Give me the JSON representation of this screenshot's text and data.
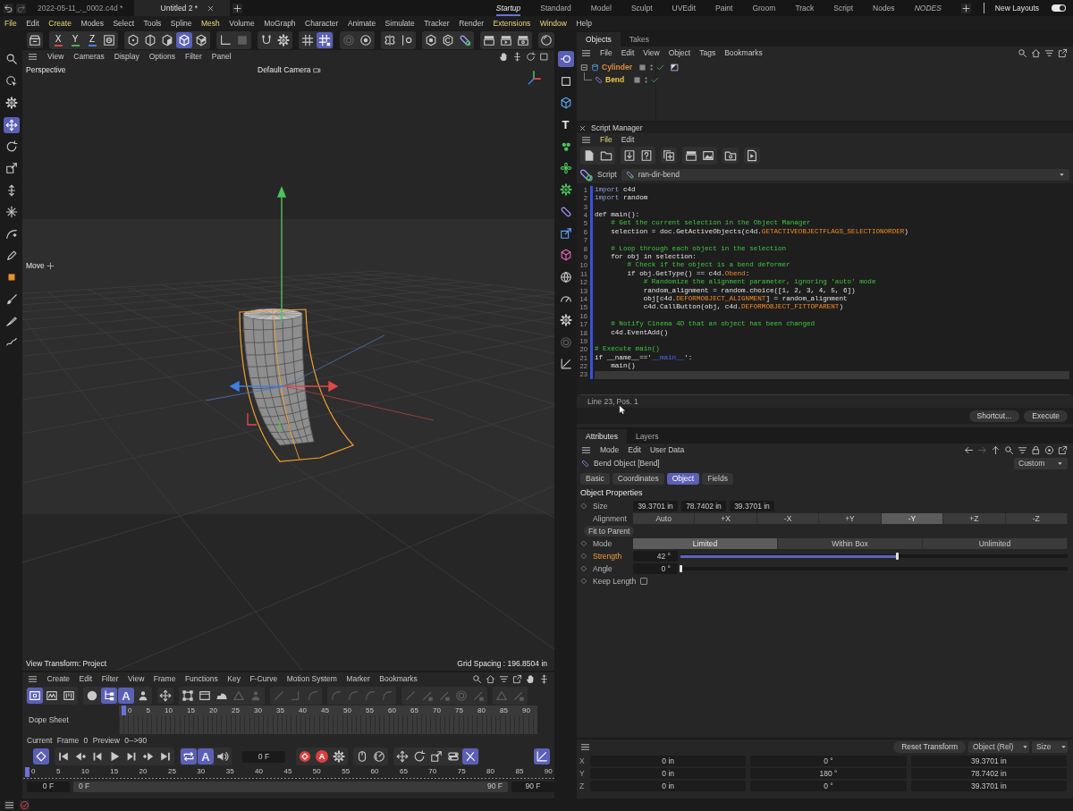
{
  "top_bar": {
    "file_tabs": [
      {
        "label": "2022-05-11_._0002.c4d *",
        "selected": false
      },
      {
        "label": "Untitled 2 *",
        "selected": true
      }
    ],
    "layouts": [
      {
        "label": "Startup",
        "selected": true,
        "italic": true
      },
      {
        "label": "Standard",
        "selected": false,
        "italic": false
      },
      {
        "label": "Model",
        "selected": false,
        "italic": false
      },
      {
        "label": "Sculpt",
        "selected": false,
        "italic": false
      },
      {
        "label": "UVEdit",
        "selected": false,
        "italic": false
      },
      {
        "label": "Paint",
        "selected": false,
        "italic": false
      },
      {
        "label": "Groom",
        "selected": false,
        "italic": false
      },
      {
        "label": "Track",
        "selected": false,
        "italic": false
      },
      {
        "label": "Script",
        "selected": false,
        "italic": false
      },
      {
        "label": "Nodes",
        "selected": false,
        "italic": false
      },
      {
        "label": "NODES",
        "selected": false,
        "italic": true
      }
    ],
    "new_layouts": {
      "label": "New Layouts",
      "on": true
    }
  },
  "menu_bar": [
    {
      "label": "File",
      "highlighted": true
    },
    {
      "label": "Edit",
      "highlighted": false
    },
    {
      "label": "Create",
      "highlighted": true
    },
    {
      "label": "Modes",
      "highlighted": false
    },
    {
      "label": "Select",
      "highlighted": false
    },
    {
      "label": "Tools",
      "highlighted": false
    },
    {
      "label": "Spline",
      "highlighted": false
    },
    {
      "label": "Mesh",
      "highlighted": true
    },
    {
      "label": "Volume",
      "highlighted": false
    },
    {
      "label": "MoGraph",
      "highlighted": false
    },
    {
      "label": "Character",
      "highlighted": false
    },
    {
      "label": "Animate",
      "highlighted": false
    },
    {
      "label": "Simulate",
      "highlighted": false
    },
    {
      "label": "Tracker",
      "highlighted": false
    },
    {
      "label": "Render",
      "highlighted": false
    },
    {
      "label": "Extensions",
      "highlighted": true
    },
    {
      "label": "Window",
      "highlighted": true
    },
    {
      "label": "Help",
      "highlighted": false
    }
  ],
  "main_toolbar": [
    {
      "buttons": [
        {
          "kind": "icon",
          "on": false,
          "disabled": false
        }
      ]
    },
    {
      "buttons": [
        {
          "kind": "axis",
          "glyph": "X",
          "color": "#d24545",
          "on": false,
          "disabled": false
        },
        {
          "kind": "axis",
          "glyph": "Y",
          "color": "#45b04c",
          "on": false,
          "disabled": false
        },
        {
          "kind": "axis",
          "glyph": "Z",
          "color": "#3f7fe0",
          "on": false,
          "disabled": false
        },
        {
          "kind": "icon",
          "on": false,
          "disabled": false
        }
      ]
    },
    {
      "buttons": [
        {
          "kind": "icon",
          "on": false,
          "disabled": false
        },
        {
          "kind": "icon",
          "on": false,
          "disabled": false
        },
        {
          "kind": "icon",
          "on": false,
          "disabled": false
        },
        {
          "kind": "icon",
          "on": true,
          "disabled": false
        },
        {
          "kind": "icon",
          "on": false,
          "disabled": false
        }
      ]
    },
    {
      "buttons": [
        {
          "kind": "icon",
          "on": false,
          "disabled": false
        },
        {
          "kind": "icon",
          "on": false,
          "disabled": true
        }
      ]
    },
    {
      "buttons": [
        {
          "kind": "icon",
          "on": false,
          "disabled": false
        },
        {
          "kind": "icon",
          "on": false,
          "disabled": false
        }
      ]
    },
    {
      "buttons": [
        {
          "kind": "icon",
          "on": false,
          "disabled": false
        },
        {
          "kind": "icon",
          "on": true,
          "disabled": false
        }
      ]
    },
    {
      "buttons": [
        {
          "kind": "icon",
          "on": false,
          "disabled": true
        },
        {
          "kind": "icon",
          "on": false,
          "disabled": false
        }
      ]
    },
    {
      "buttons": [
        {
          "kind": "icon",
          "on": false,
          "disabled": false
        },
        {
          "kind": "icon",
          "on": false,
          "disabled": false
        }
      ]
    },
    {
      "buttons": [
        {
          "kind": "icon",
          "on": false,
          "disabled": false
        },
        {
          "kind": "icon",
          "on": false,
          "disabled": false
        },
        {
          "kind": "icon",
          "on": false,
          "disabled": false
        }
      ]
    },
    {
      "buttons": [
        {
          "kind": "icon",
          "on": false,
          "disabled": false
        },
        {
          "kind": "icon",
          "on": false,
          "disabled": false
        },
        {
          "kind": "icon",
          "on": false,
          "disabled": false
        }
      ]
    },
    {
      "buttons": [
        {
          "kind": "icon",
          "on": false,
          "disabled": false
        }
      ]
    }
  ],
  "left_tools": [
    {
      "buttons": [
        {
          "kind": "icon",
          "on": false
        }
      ]
    },
    {
      "buttons": [
        {
          "kind": "icon",
          "on": false
        },
        {
          "kind": "icon",
          "on": false
        }
      ]
    },
    {
      "buttons": [
        {
          "kind": "icon",
          "on": true
        },
        {
          "kind": "icon",
          "on": false
        },
        {
          "kind": "icon",
          "on": false
        }
      ]
    },
    {
      "buttons": [
        {
          "kind": "icon",
          "on": false
        },
        {
          "kind": "icon",
          "on": false
        }
      ]
    },
    {
      "buttons": [
        {
          "kind": "icon",
          "on": false
        },
        {
          "kind": "icon",
          "on": false
        },
        {
          "kind": "icon",
          "on": false
        }
      ]
    },
    {
      "buttons": [
        {
          "kind": "icon",
          "on": false
        },
        {
          "kind": "icon",
          "on": false
        },
        {
          "kind": "icon",
          "on": false
        }
      ]
    }
  ],
  "side_tools": [
    {
      "buttons": [
        {
          "kind": "icon",
          "on": true,
          "disabled": false
        }
      ]
    },
    {
      "buttons": [
        {
          "kind": "icon",
          "on": false,
          "disabled": false
        },
        {
          "kind": "icon",
          "on": false,
          "disabled": false
        },
        {
          "kind": "glyph",
          "glyph": "T",
          "on": false,
          "disabled": false
        }
      ]
    },
    {
      "buttons": [
        {
          "kind": "icon",
          "on": false,
          "disabled": false
        },
        {
          "kind": "icon",
          "on": false,
          "disabled": false
        },
        {
          "kind": "icon",
          "on": false,
          "disabled": false
        }
      ]
    },
    {
      "buttons": [
        {
          "kind": "icon",
          "on": false,
          "disabled": false
        },
        {
          "kind": "icon",
          "on": false,
          "disabled": false
        },
        {
          "kind": "icon",
          "on": false,
          "disabled": false
        }
      ]
    },
    {
      "buttons": [
        {
          "kind": "icon",
          "on": false,
          "disabled": false
        },
        {
          "kind": "icon",
          "on": false,
          "disabled": false
        },
        {
          "kind": "icon",
          "on": false,
          "disabled": false
        }
      ]
    },
    {
      "buttons": [
        {
          "kind": "icon",
          "on": false,
          "disabled": true
        },
        {
          "kind": "icon",
          "on": false,
          "disabled": false
        }
      ]
    }
  ],
  "viewport": {
    "menu": [
      "View",
      "Cameras",
      "Display",
      "Options",
      "Filter",
      "Panel"
    ],
    "view_name": "Perspective",
    "camera": "Default Camera",
    "tool": "Move",
    "view_transform": "View Transform: Project",
    "grid_spacing": "Grid Spacing : 196.8504 in"
  },
  "timeline": {
    "menu": [
      "Create",
      "Edit",
      "Filter",
      "View",
      "Frame",
      "Functions",
      "Key",
      "F-Curve",
      "Motion System",
      "Marker",
      "Bookmarks"
    ],
    "toolbar": [
      {
        "buttons": [
          {
            "kind": "icon",
            "on": true,
            "disabled": false
          },
          {
            "kind": "icon",
            "on": false,
            "disabled": false
          },
          {
            "kind": "icon",
            "on": false,
            "disabled": false
          }
        ]
      },
      {
        "buttons": [
          {
            "kind": "icon",
            "on": false,
            "disabled": false
          },
          {
            "kind": "icon",
            "on": true,
            "disabled": false
          },
          {
            "kind": "glyph",
            "glyph": "A",
            "on": true,
            "disabled": false
          },
          {
            "kind": "icon",
            "on": false,
            "disabled": false
          }
        ]
      },
      {
        "buttons": [
          {
            "kind": "icon",
            "on": false,
            "disabled": false
          }
        ]
      },
      {
        "buttons": [
          {
            "kind": "icon",
            "on": false,
            "disabled": false
          },
          {
            "kind": "icon",
            "on": false,
            "disabled": false
          },
          {
            "kind": "icon",
            "on": false,
            "disabled": false
          },
          {
            "kind": "icon",
            "on": false,
            "disabled": true
          },
          {
            "kind": "icon",
            "on": false,
            "disabled": true
          }
        ]
      },
      {
        "buttons": [
          {
            "kind": "icon",
            "on": false,
            "disabled": true
          },
          {
            "kind": "icon",
            "on": false,
            "disabled": true
          },
          {
            "kind": "icon",
            "on": false,
            "disabled": true
          }
        ]
      },
      {
        "buttons": [
          {
            "kind": "icon",
            "on": false,
            "disabled": true
          },
          {
            "kind": "icon",
            "on": false,
            "disabled": true
          },
          {
            "kind": "icon",
            "on": false,
            "disabled": true
          },
          {
            "kind": "icon",
            "on": false,
            "disabled": true
          }
        ]
      },
      {
        "buttons": [
          {
            "kind": "icon",
            "on": false,
            "disabled": true
          },
          {
            "kind": "icon",
            "on": false,
            "disabled": true
          },
          {
            "kind": "icon",
            "on": false,
            "disabled": true
          },
          {
            "kind": "icon",
            "on": false,
            "disabled": true
          },
          {
            "kind": "icon",
            "on": false,
            "disabled": true
          }
        ]
      },
      {
        "buttons": [
          {
            "kind": "icon",
            "on": false,
            "disabled": true
          },
          {
            "kind": "icon",
            "on": false,
            "disabled": true
          }
        ]
      }
    ],
    "dope_sheet": {
      "label": "Dope Sheet",
      "ticks": [
        "0",
        "5",
        "10",
        "15",
        "20",
        "25",
        "30",
        "35",
        "40",
        "45",
        "50",
        "55",
        "60",
        "65",
        "70",
        "75",
        "80",
        "85",
        "90"
      ],
      "playhead": {
        "level": 0
      }
    },
    "frame_info": "Current Frame 0 Preview 0-->90",
    "transport": {
      "left": [
        {
          "buttons": [
            {
              "kind": "icon",
              "on": true
            }
          ]
        },
        {
          "buttons": [
            {
              "kind": "icon",
              "on": false
            },
            {
              "kind": "icon",
              "on": false
            },
            {
              "kind": "icon",
              "on": false
            },
            {
              "kind": "icon",
              "on": false
            },
            {
              "kind": "icon",
              "on": false
            },
            {
              "kind": "icon",
              "on": false
            },
            {
              "kind": "icon",
              "on": false
            }
          ]
        },
        {
          "buttons": [
            {
              "kind": "icon",
              "on": true
            },
            {
              "kind": "glyph",
              "glyph": "A",
              "on": true
            },
            {
              "kind": "icon",
              "on": false
            }
          ]
        }
      ],
      "frame_field": "0 F",
      "right": [
        {
          "buttons": [
            {
              "kind": "icon",
              "on": false
            },
            {
              "kind": "record_glyph",
              "glyph": "A",
              "on": false
            },
            {
              "kind": "icon",
              "on": false
            }
          ]
        },
        {
          "buttons": [
            {
              "kind": "icon",
              "on": false
            },
            {
              "kind": "icon",
              "on": false
            }
          ]
        },
        {
          "buttons": [
            {
              "kind": "icon",
              "on": false
            },
            {
              "kind": "icon",
              "on": false
            },
            {
              "kind": "icon",
              "on": false
            },
            {
              "kind": "icon",
              "on": false
            },
            {
              "kind": "icon",
              "on": true
            }
          ]
        }
      ],
      "end": [
        {
          "buttons": [
            {
              "kind": "icon",
              "on": true
            }
          ]
        }
      ]
    },
    "ruler": {
      "ticks": [
        "0",
        "5",
        "10",
        "15",
        "20",
        "25",
        "30",
        "35",
        "40",
        "45",
        "50",
        "55",
        "60",
        "65",
        "70",
        "75",
        "80",
        "85",
        "90"
      ],
      "playhead": {
        "level": 0
      }
    },
    "start_field": "0 F",
    "range": {
      "start": "0 F",
      "end": "90 F"
    },
    "end_field": "90 F"
  },
  "objects": {
    "tabs": [
      {
        "label": "Objects",
        "selected": true
      },
      {
        "label": "Takes",
        "selected": false
      }
    ],
    "menu": [
      "File",
      "Edit",
      "View",
      "Object",
      "Tags",
      "Bookmarks"
    ],
    "tree": [
      {
        "name": "Cylinder",
        "color": "#e08a3c",
        "enabled": true,
        "tagged": true,
        "expanded": true,
        "children": [
          {
            "name": "Bend",
            "color": "#e8c24a",
            "enabled": true,
            "tagged": false
          }
        ]
      }
    ]
  },
  "script_manager": {
    "title": "Script Manager",
    "menu": [
      {
        "label": "File",
        "highlighted": true
      },
      {
        "label": "Edit",
        "highlighted": false
      }
    ],
    "toolbar": [
      {
        "buttons": [
          {
            "kind": "icon",
            "on": false
          },
          {
            "kind": "icon",
            "on": false
          }
        ]
      },
      {
        "buttons": [
          {
            "kind": "icon",
            "on": false
          },
          {
            "kind": "icon",
            "on": false
          }
        ]
      },
      {
        "buttons": [
          {
            "kind": "icon",
            "on": false
          }
        ]
      },
      {
        "buttons": [
          {
            "kind": "icon",
            "on": false
          },
          {
            "kind": "icon",
            "on": false
          }
        ]
      },
      {
        "buttons": [
          {
            "kind": "icon",
            "on": false
          }
        ]
      },
      {
        "buttons": [
          {
            "kind": "icon",
            "on": false
          }
        ]
      }
    ],
    "script_label": "Script",
    "script_name": "ran-dir-bend",
    "code": [
      {
        "num": "1",
        "current": false,
        "segments": [
          {
            "text": "import",
            "kind": "keyword"
          },
          {
            "text": " c4d",
            "kind": "plain"
          }
        ]
      },
      {
        "num": "2",
        "current": false,
        "segments": [
          {
            "text": "import",
            "kind": "keyword"
          },
          {
            "text": " random",
            "kind": "plain"
          }
        ]
      },
      {
        "num": "3",
        "current": false
      },
      {
        "num": "4",
        "current": false,
        "segments": [
          {
            "text": "def main():",
            "kind": "plain"
          }
        ]
      },
      {
        "num": "5",
        "current": false,
        "segments": [
          {
            "text": "    # Get the current selection in the Object Manager",
            "kind": "comment"
          }
        ]
      },
      {
        "num": "6",
        "current": false,
        "segments": [
          {
            "text": "    selection = doc.GetActiveObjects(c4d.",
            "kind": "plain"
          },
          {
            "text": "GETACTIVEOBJECTFLAGS_SELECTIONORDER",
            "kind": "constant"
          },
          {
            "text": ")",
            "kind": "plain"
          }
        ]
      },
      {
        "num": "7",
        "current": false
      },
      {
        "num": "8",
        "current": false,
        "segments": [
          {
            "text": "    # Loop through each object in the selection",
            "kind": "comment"
          }
        ]
      },
      {
        "num": "9",
        "current": false,
        "segments": [
          {
            "text": "    for obj in selection:",
            "kind": "plain"
          }
        ]
      },
      {
        "num": "10",
        "current": false,
        "segments": [
          {
            "text": "        # Check if the object is a bend deformer",
            "kind": "comment"
          }
        ]
      },
      {
        "num": "11",
        "current": false,
        "segments": [
          {
            "text": "        if obj.GetType() == c4d.",
            "kind": "plain"
          },
          {
            "text": "Obend",
            "kind": "constant"
          },
          {
            "text": ":",
            "kind": "plain"
          }
        ]
      },
      {
        "num": "12",
        "current": false,
        "segments": [
          {
            "text": "            # Randomize the alignment parameter, ignoring 'auto' mode",
            "kind": "comment"
          }
        ]
      },
      {
        "num": "13",
        "current": false,
        "segments": [
          {
            "text": "            random_alignment = random.choice([1, 2, 3, 4, 5, 6])",
            "kind": "plain"
          }
        ]
      },
      {
        "num": "14",
        "current": false,
        "segments": [
          {
            "text": "            obj[c4d.",
            "kind": "plain"
          },
          {
            "text": "DEFORMOBJECT_ALIGNMENT",
            "kind": "constant"
          },
          {
            "text": "] = random_alignment",
            "kind": "plain"
          }
        ]
      },
      {
        "num": "15",
        "current": false,
        "segments": [
          {
            "text": "            c4d.CallButton(obj, c4d.",
            "kind": "plain"
          },
          {
            "text": "DEFORMOBJECT_FITTOPARENT",
            "kind": "constant"
          },
          {
            "text": ")",
            "kind": "plain"
          }
        ]
      },
      {
        "num": "16",
        "current": false
      },
      {
        "num": "17",
        "current": false,
        "segments": [
          {
            "text": "    # Notify Cinema 4D that an object has been changed",
            "kind": "comment"
          }
        ]
      },
      {
        "num": "18",
        "current": false,
        "segments": [
          {
            "text": "    c4d.EventAdd()",
            "kind": "plain"
          }
        ]
      },
      {
        "num": "19",
        "current": false
      },
      {
        "num": "20",
        "current": false,
        "segments": [
          {
            "text": "# Execute main()",
            "kind": "comment"
          }
        ]
      },
      {
        "num": "21",
        "current": false,
        "segments": [
          {
            "text": "if __name__=='",
            "kind": "plain"
          },
          {
            "text": "__main__",
            "kind": "string"
          },
          {
            "text": "':",
            "kind": "plain"
          }
        ]
      },
      {
        "num": "22",
        "current": false,
        "segments": [
          {
            "text": "    main()",
            "kind": "plain"
          }
        ]
      },
      {
        "num": "23",
        "current": true
      }
    ],
    "status": "Line 23, Pos. 1",
    "buttons": [
      "Shortcut...",
      "Execute"
    ]
  },
  "attributes": {
    "tabs": [
      {
        "label": "Attributes",
        "selected": true
      },
      {
        "label": "Layers",
        "selected": false
      }
    ],
    "menu": [
      "Mode",
      "Edit",
      "User Data"
    ],
    "nav": [
      {
        "disabled": false
      },
      {
        "disabled": true
      },
      {
        "disabled": false
      },
      {
        "disabled": false
      },
      {
        "disabled": false
      },
      {
        "disabled": false
      },
      {
        "disabled": false
      },
      {
        "disabled": false
      }
    ],
    "title": "Bend Object [Bend]",
    "preset": "Custom",
    "subtabs": [
      {
        "label": "Basic",
        "selected": false
      },
      {
        "label": "Coordinates",
        "selected": false
      },
      {
        "label": "Object",
        "selected": true
      },
      {
        "label": "Fields",
        "selected": false
      }
    ],
    "section": "Object Properties",
    "rows": [
      {
        "kind": "vector",
        "label": "Size",
        "keyframe": true,
        "highlighted": false,
        "values": [
          "39.3701 in",
          "78.7402 in",
          "39.3701 in"
        ]
      },
      {
        "kind": "segmented",
        "label": "Alignment",
        "keyframe": false,
        "highlighted": false,
        "options": [
          {
            "label": "Auto",
            "selected": false
          },
          {
            "label": "+X",
            "selected": false
          },
          {
            "label": "-X",
            "selected": false
          },
          {
            "label": "+Y",
            "selected": false
          },
          {
            "label": "-Y",
            "selected": true
          },
          {
            "label": "+Z",
            "selected": false
          },
          {
            "label": "-Z",
            "selected": false
          }
        ]
      },
      {
        "kind": "button",
        "label": "Fit to Parent",
        "keyframe": false,
        "highlighted": false
      },
      {
        "kind": "segmented",
        "label": "Mode",
        "keyframe": true,
        "highlighted": false,
        "options": [
          {
            "label": "Limited",
            "selected": true
          },
          {
            "label": "Within Box",
            "selected": false
          },
          {
            "label": "Unlimited",
            "selected": false
          }
        ]
      },
      {
        "kind": "slider",
        "label": "Strength",
        "keyframe": true,
        "highlighted": true,
        "value": "42 °",
        "level": 0.56
      },
      {
        "kind": "slider",
        "label": "Angle",
        "keyframe": true,
        "highlighted": false,
        "value": "0 °",
        "level": 0
      },
      {
        "kind": "checkbox",
        "label": "Keep Length",
        "keyframe": true,
        "highlighted": false,
        "checked": false
      }
    ]
  },
  "coordinates": {
    "reset": "Reset Transform",
    "mode": "Object (Rel)",
    "column": "Size",
    "rows": [
      {
        "axis": "X",
        "values": [
          "0 in",
          "0 °",
          "39.3701 in"
        ]
      },
      {
        "axis": "Y",
        "values": [
          "0 in",
          "180 °",
          "78.7402 in"
        ]
      },
      {
        "axis": "Z",
        "values": [
          "0 in",
          "0 °",
          "39.3701 in"
        ]
      }
    ]
  }
}
